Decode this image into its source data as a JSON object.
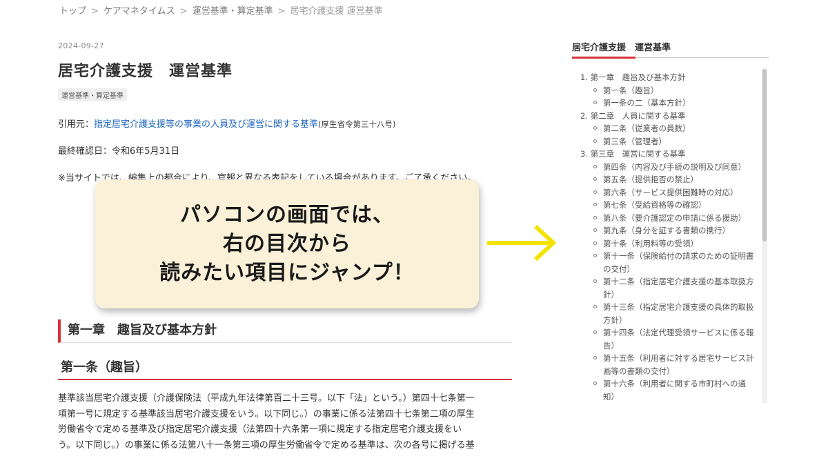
{
  "breadcrumb": [
    "トップ",
    "ケアマネタイムス",
    "運営基準・算定基準",
    "居宅介護支援 運営基準"
  ],
  "breadcrumb_separator": ">",
  "post": {
    "date": "2024-09-27",
    "title": "居宅介護支援　運営基準",
    "tag": "運営基準・算定基準",
    "citation_prefix": "引用元：",
    "citation_link": "指定居宅介護支援等の事業の人員及び運営に関する基準",
    "citation_suffix": "(厚生省令第三十八号)",
    "checked": "最終確認日：令和6年5月31日",
    "notice": "※当サイトでは、編集上の都合により、官報と異なる表記をしている場合があります。ご了承ください。"
  },
  "chapter_heading": "第一章　趣旨及び基本方針",
  "article_heading": "第一条（趣旨）",
  "body_lines": [
    "基準該当居宅介護支援（介護保険法（平成九年法律第百二十三号。以下「法」という。）第四十七条第一",
    "項第一号に規定する基準該当居宅介護支援をいう。以下同じ。）の事業に係る法第四十七条第二項の厚生",
    "労働省令で定める基準及び指定居宅介護支援（法第四十六条第一項に規定する指定居宅介護支援をい",
    "う。以下同じ。）の事業に係る法第八十一条第三項の厚生労働省令で定める基準は、次の各号に掲げる基"
  ],
  "callout_lines": [
    "パソコンの画面では、",
    "右の目次から",
    "読みたい項目にジャンプ！"
  ],
  "toc": {
    "title": "居宅介護支援　運営基準",
    "items": [
      {
        "type": "chapter",
        "label": "1. 第一章　趣旨及び基本方針"
      },
      {
        "type": "article",
        "label": "第一条（趣旨）"
      },
      {
        "type": "article",
        "label": "第一条の二（基本方針）"
      },
      {
        "type": "chapter",
        "label": "2. 第二章　人員に関する基準"
      },
      {
        "type": "article",
        "label": "第二条（従業者の員数）"
      },
      {
        "type": "article",
        "label": "第三条（管理者）"
      },
      {
        "type": "chapter",
        "label": "3. 第三章　運営に関する基準"
      },
      {
        "type": "article",
        "label": "第四条（内容及び手続の説明及び同意）"
      },
      {
        "type": "article",
        "label": "第五条（提供拒否の禁止）"
      },
      {
        "type": "article",
        "label": "第六条（サービス提供困難時の対応）"
      },
      {
        "type": "article",
        "label": "第七条（受給資格等の確認）"
      },
      {
        "type": "article",
        "label": "第八条（要介護認定の申請に係る援助）"
      },
      {
        "type": "article",
        "label": "第九条（身分を証する書類の携行）"
      },
      {
        "type": "article",
        "label": "第十条（利用料等の受領）"
      },
      {
        "type": "article",
        "label": "第十一条（保険給付の請求のための証明書の交付）"
      },
      {
        "type": "article",
        "label": "第十二条（指定居宅介護支援の基本取扱方針）"
      },
      {
        "type": "article",
        "label": "第十三条（指定居宅介護支援の具体的取扱方針）"
      },
      {
        "type": "article",
        "label": "第十四条（法定代理受領サービスに係る報告）"
      },
      {
        "type": "article",
        "label": "第十五条（利用者に対する居宅サービス計画等の書類の交付）"
      },
      {
        "type": "article",
        "label": "第十六条（利用者に関する市町村への通知）"
      }
    ]
  },
  "colors": {
    "accent_red": "#d8323c",
    "link_blue": "#1f66c1",
    "callout_bg": "#faf1d8",
    "arrow_yellow": "#f4e300"
  },
  "icons": {
    "arrow": "arrow-right-icon",
    "toc_bullet": "circle-bullet-icon"
  }
}
